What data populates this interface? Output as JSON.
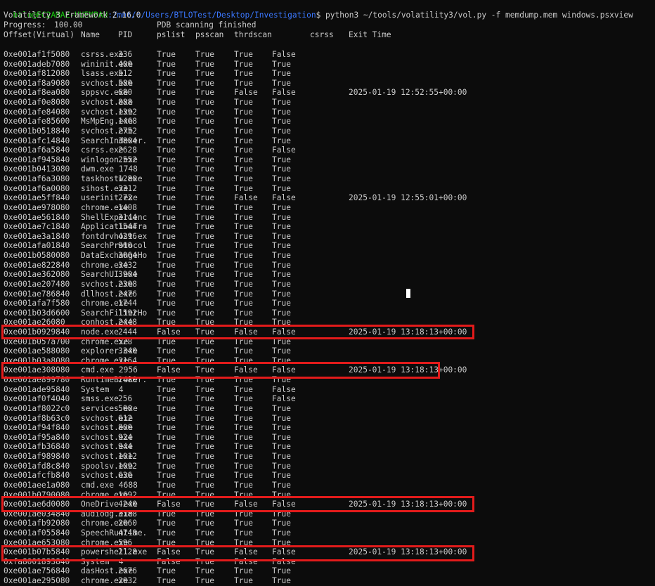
{
  "prompt": {
    "user_host": "btlo@EC2AMAZ-UUEMPAU",
    "path": ":/mnt/c/Users/BTLOTest/Desktop/Investigation",
    "command": "$ python3 ~/tools/volatility3/vol.py -f memdump.mem windows.psxview"
  },
  "banner": "Volatility 3 Framework 2.16.0",
  "progress": {
    "label": "Progress:",
    "value": "100.00",
    "status": "PDB scanning finished"
  },
  "headers": [
    "Offset(Virtual)",
    "Name",
    "PID",
    "pslist",
    "psscan",
    "thrdscan",
    "csrss",
    "Exit Time"
  ],
  "rows": [
    [
      "0xe001af1f5080",
      "csrss.exe",
      "336",
      "True",
      "True",
      "True",
      "False",
      ""
    ],
    [
      "0xe001adeb7080",
      "wininit.exe",
      "400",
      "True",
      "True",
      "True",
      "True",
      ""
    ],
    [
      "0xe001af812080",
      "lsass.exe",
      "512",
      "True",
      "True",
      "True",
      "True",
      ""
    ],
    [
      "0xe001af8a9080",
      "svchost.exe",
      "580",
      "True",
      "True",
      "True",
      "True",
      ""
    ],
    [
      "0xe001af8ea080",
      "sppsvc.exe",
      "680",
      "True",
      "True",
      "False",
      "False",
      "2025-01-19 12:52:55+00:00"
    ],
    [
      "0xe001af0e8080",
      "svchost.exe",
      "888",
      "True",
      "True",
      "True",
      "True",
      ""
    ],
    [
      "0xe001afe84080",
      "svchost.exe",
      "1392",
      "True",
      "True",
      "True",
      "True",
      ""
    ],
    [
      "0xe001afe85600",
      "MsMpEng.exe",
      "1468",
      "True",
      "True",
      "True",
      "True",
      ""
    ],
    [
      "0xe001b0518840",
      "svchost.exe",
      "2752",
      "True",
      "True",
      "True",
      "True",
      ""
    ],
    [
      "0xe001afc14840",
      "SearchIndexer.",
      "3804",
      "True",
      "True",
      "True",
      "True",
      ""
    ],
    [
      "0xe001af6a5840",
      "csrss.exe",
      "2628",
      "True",
      "True",
      "True",
      "False",
      ""
    ],
    [
      "0xe001af945840",
      "winlogon.exe",
      "2552",
      "True",
      "True",
      "True",
      "True",
      ""
    ],
    [
      "0xe001b0413080",
      "dwm.exe 1748",
      "",
      "True",
      "True",
      "True",
      "True",
      ""
    ],
    [
      "0xe001af6a3080",
      "taskhostw.exe",
      "1280",
      "True",
      "True",
      "True",
      "True",
      ""
    ],
    [
      "0xe001af6a0080",
      "sihost.exe",
      "3312",
      "True",
      "True",
      "True",
      "True",
      ""
    ],
    [
      "0xe001ae5ff840",
      "userinit.exe",
      "272",
      "True",
      "True",
      "False",
      "False",
      "2025-01-19 12:55:01+00:00"
    ],
    [
      "0xe001ae978080",
      "chrome.exe",
      "1408",
      "True",
      "True",
      "True",
      "True",
      ""
    ],
    [
      "0xe001ae561840",
      "ShellExperienc",
      "3144",
      "True",
      "True",
      "True",
      "True",
      ""
    ],
    [
      "0xe001ae7c1840",
      "ApplicationFra",
      "1544",
      "True",
      "True",
      "True",
      "True",
      ""
    ],
    [
      "0xe001ae3a1840",
      "fontdrvhost.ex",
      "4296",
      "True",
      "True",
      "True",
      "True",
      ""
    ],
    [
      "0xe001afa01840",
      "SearchProtocol",
      "960",
      "True",
      "True",
      "True",
      "True",
      ""
    ],
    [
      "0xe001b0580080",
      "DataExchangeHo",
      "3064",
      "True",
      "True",
      "True",
      "True",
      ""
    ],
    [
      "0xe001ae822840",
      "chrome.exe",
      "3432",
      "True",
      "True",
      "True",
      "True",
      ""
    ],
    [
      "0xe001ae362080",
      "SearchUI.exe",
      "3904",
      "True",
      "True",
      "True",
      "True",
      ""
    ],
    [
      "0xe001ae207480",
      "svchost.exe",
      "2308",
      "True",
      "True",
      "True",
      "True",
      ""
    ],
    [
      "0xe001ae786840",
      "dllhost.exe",
      "2476",
      "True",
      "True",
      "True",
      "True",
      ""
    ],
    [
      "0xe001afa7f580",
      "chrome.exe",
      "1744",
      "True",
      "True",
      "True",
      "True",
      ""
    ],
    [
      "0xe001b03d6600",
      "SearchFilterHo",
      "1592",
      "True",
      "True",
      "True",
      "True",
      ""
    ],
    [
      "0xe001ae26080",
      "conhost.exe",
      "2448",
      "True",
      "True",
      "True",
      "True",
      ""
    ],
    [
      "0xe001b0929840",
      "node.exe",
      "2444",
      "False",
      "True",
      "False",
      "False",
      "2025-01-19 13:18:13+00:00"
    ],
    [
      "0xe001b057a700",
      "chrome.exe",
      "528",
      "True",
      "True",
      "True",
      "True",
      ""
    ],
    [
      "0xe001ae588080",
      "explorer.exe",
      "3340",
      "True",
      "True",
      "True",
      "True",
      ""
    ],
    [
      "0xe001b03a8080",
      "chrome.exe",
      "3164",
      "True",
      "True",
      "True",
      "True",
      ""
    ],
    [
      "0xe001ae308080",
      "cmd.exe 2956",
      "",
      "False",
      "True",
      "False",
      "False",
      "2025-01-19 13:18:13+00:00"
    ],
    [
      "0xe001ae899780",
      "RuntimeBroker.",
      "2480",
      "True",
      "True",
      "True",
      "True",
      ""
    ],
    [
      "0xe001ade95840",
      "System  4",
      "",
      "True",
      "True",
      "True",
      "False",
      ""
    ],
    [
      "0xe001af0f4040",
      "smss.exe",
      "256",
      "True",
      "True",
      "True",
      "False",
      ""
    ],
    [
      "0xe001af8022c0",
      "services.exe",
      "500",
      "True",
      "True",
      "True",
      "True",
      ""
    ],
    [
      "0xe001af8b63c0",
      "svchost.exe",
      "612",
      "True",
      "True",
      "True",
      "True",
      ""
    ],
    [
      "0xe001af94f840",
      "svchost.exe",
      "800",
      "True",
      "True",
      "True",
      "True",
      ""
    ],
    [
      "0xe001af95a840",
      "svchost.exe",
      "924",
      "True",
      "True",
      "True",
      "True",
      ""
    ],
    [
      "0xe001afb36840",
      "svchost.exe",
      "944",
      "True",
      "True",
      "True",
      "True",
      ""
    ],
    [
      "0xe001af989840",
      "svchost.exe",
      "1012",
      "True",
      "True",
      "True",
      "True",
      ""
    ],
    [
      "0xe001afd8c840",
      "spoolsv.exe",
      "1092",
      "True",
      "True",
      "True",
      "True",
      ""
    ],
    [
      "0xe001afcfb840",
      "svchost.exe",
      "636",
      "True",
      "True",
      "True",
      "True",
      ""
    ],
    [
      "0xe001aee1a080",
      "cmd.exe 4688",
      "",
      "True",
      "True",
      "True",
      "True",
      ""
    ],
    [
      "0xe001b0790080",
      "chrome.exe",
      "1692",
      "True",
      "True",
      "True",
      "True",
      ""
    ],
    [
      "0xe001ae6d0080",
      "OneDrive.exe",
      "4240",
      "False",
      "True",
      "False",
      "False",
      "2025-01-19 13:18:13+00:00"
    ],
    [
      "0xe001ae034840",
      "audiodg.exe",
      "3188",
      "True",
      "True",
      "True",
      "True",
      ""
    ],
    [
      "0xe001afb92080",
      "chrome.exe",
      "2060",
      "True",
      "True",
      "True",
      "True",
      ""
    ],
    [
      "0xe001af055840",
      "SpeechRuntime.",
      "4748",
      "True",
      "True",
      "True",
      "True",
      ""
    ],
    [
      "0xe001ae653080",
      "chrome.exe",
      "596",
      "True",
      "True",
      "True",
      "True",
      ""
    ],
    [
      "0xe001b07b5840",
      "powershell.exe",
      "2128",
      "False",
      "True",
      "False",
      "False",
      "2025-01-19 13:18:13+00:00"
    ],
    [
      "0xfa8001893840",
      "System  4",
      "",
      "False",
      "True",
      "False",
      "False",
      ""
    ],
    [
      "0xe001ae756840",
      "dasHost.exe",
      "2676",
      "True",
      "True",
      "True",
      "True",
      ""
    ],
    [
      "0xe001ae295080",
      "chrome.exe",
      "2032",
      "True",
      "True",
      "True",
      "True",
      ""
    ]
  ],
  "highlight_color": "#e31b1b"
}
